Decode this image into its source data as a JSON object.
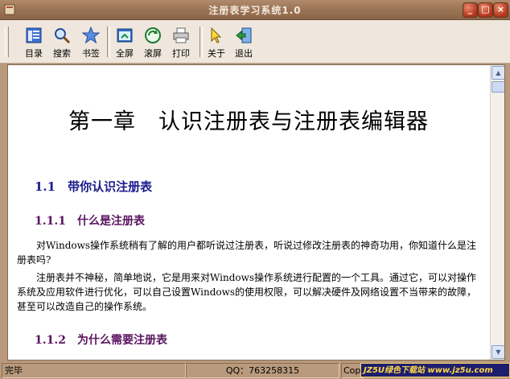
{
  "window": {
    "title": "注册表学习系统1.0"
  },
  "toolbar": {
    "buttons": [
      {
        "label": "目录",
        "icon": "contents-icon"
      },
      {
        "label": "搜索",
        "icon": "search-icon"
      },
      {
        "label": "书签",
        "icon": "bookmark-star-icon"
      },
      {
        "label": "全屏",
        "icon": "fullscreen-icon"
      },
      {
        "label": "滚屏",
        "icon": "autoscroll-icon"
      },
      {
        "label": "打印",
        "icon": "printer-icon"
      },
      {
        "label": "关于",
        "icon": "pointer-icon"
      },
      {
        "label": "退出",
        "icon": "exit-icon"
      }
    ]
  },
  "document": {
    "chapter_title": "第一章　认识注册表与注册表编辑器",
    "section_1_1": "1.1　带你认识注册表",
    "section_1_1_1": "1.1.1　什么是注册表",
    "paragraph_1": "对Windows操作系统稍有了解的用户都听说过注册表，听说过修改注册表的神奇功用，你知道什么是注册表吗?",
    "paragraph_2": "注册表并不神秘，简单地说，它是用来对Windows操作系统进行配置的一个工具。通过它，可以对操作系统及应用软件进行优化，可以自己设置Windows的使用权限，可以解决硬件及网络设置不当带来的故障，甚至可以改造自己的操作系统。",
    "section_1_1_2": "1.1.2　为什么需要注册表"
  },
  "statusbar": {
    "status": "完毕",
    "qq": "QQ：763258315",
    "copyright_partial": "Cop",
    "watermark": "JZ5U绿色下载站 www.jz5u.com"
  },
  "colors": {
    "frame": "#b99a7c",
    "toolbar_bg": "#efe7dd",
    "section_heading": "#1b1b8e",
    "subsection_heading": "#5a1560"
  }
}
